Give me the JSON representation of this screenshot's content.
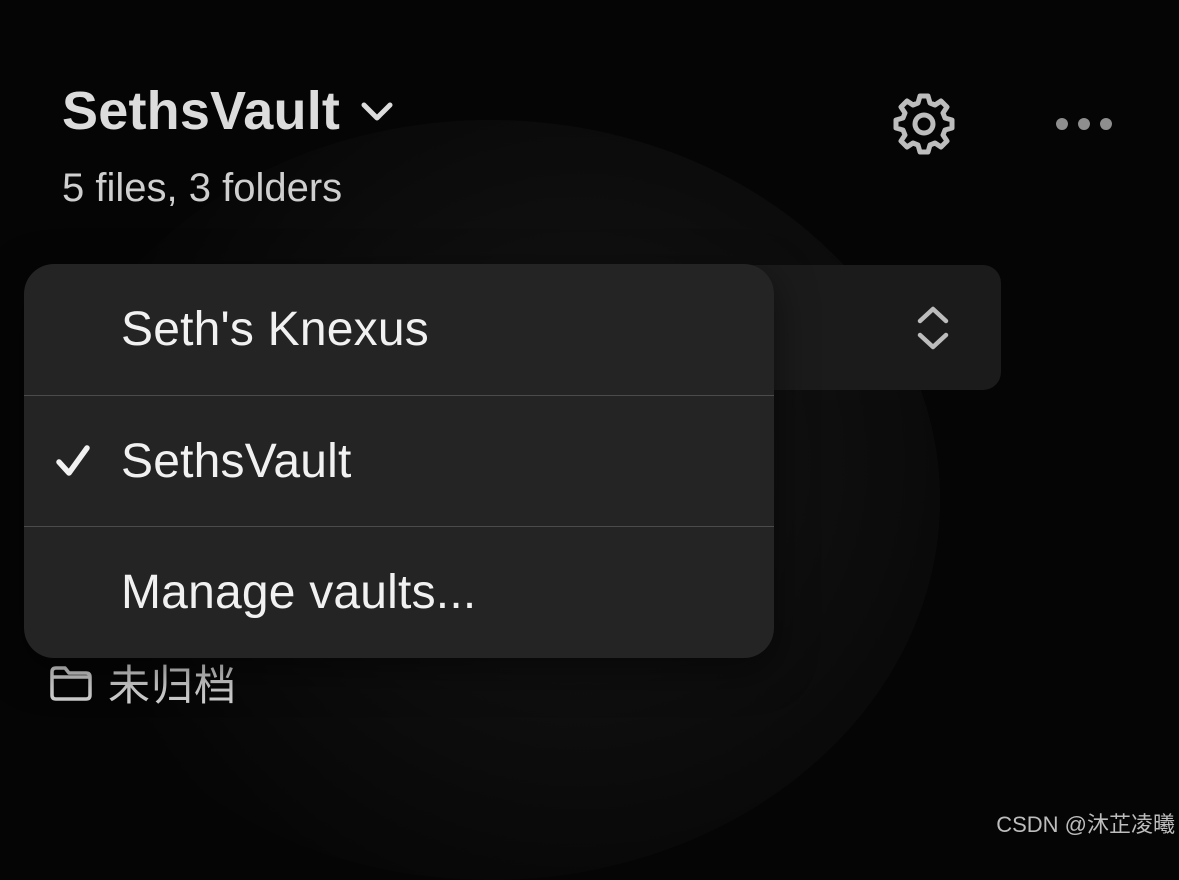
{
  "header": {
    "title": "SethsVault",
    "subtitle": "5 files, 3 folders"
  },
  "icons": {
    "title_chevron": "chevron-down-icon",
    "settings": "gear-icon",
    "more": "more-horizontal-icon",
    "stepper": "up-down-chevron-icon",
    "folder": "folder-icon"
  },
  "dropdown": {
    "items": [
      {
        "label": "Seth's Knexus",
        "selected": false
      },
      {
        "label": "SethsVault",
        "selected": true
      },
      {
        "label": "Manage vaults...",
        "selected": false
      }
    ]
  },
  "folder": {
    "label": "未归档"
  },
  "watermark": "CSDN @沐芷凌曦",
  "colors": {
    "background": "#050505",
    "menu_background": "#242424",
    "panel_background": "#1b1b1b",
    "text_primary": "#f1f1f1",
    "text_secondary": "#cfcfcf",
    "divider": "#4b4b4b"
  }
}
